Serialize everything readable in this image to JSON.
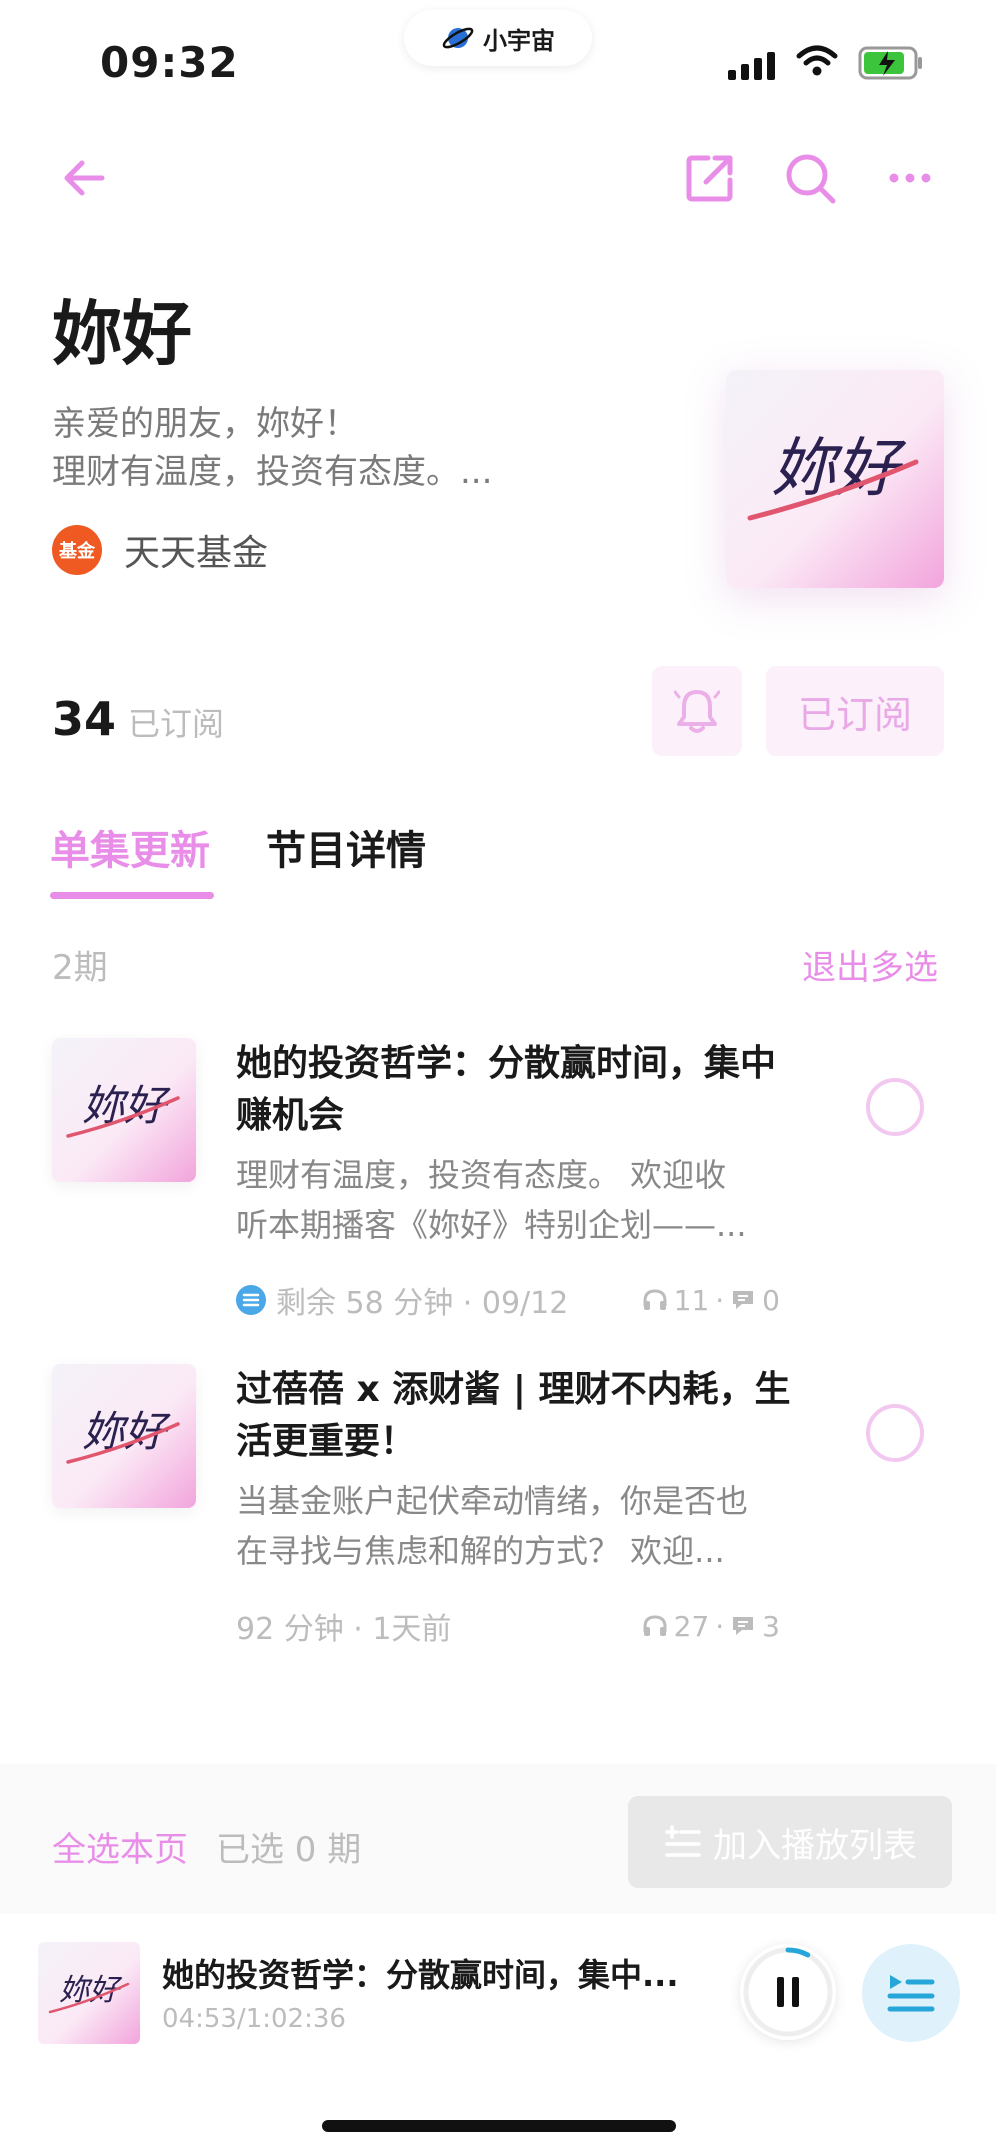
{
  "status": {
    "time": "09:32",
    "pill_label": "小宇宙"
  },
  "podcast": {
    "title": "妳好",
    "description_line1": "亲爱的朋友，妳好！",
    "description_line2": "理财有温度，投资有态度。...",
    "author_badge": "基金",
    "author": "天天基金",
    "cover_text": "妳好",
    "subscriber_count": "34",
    "subscriber_label": "已订阅",
    "subscribe_button": "已订阅"
  },
  "tabs": [
    {
      "label": "单集更新",
      "active": true
    },
    {
      "label": "节目详情",
      "active": false
    }
  ],
  "list": {
    "count": "2期",
    "exit_multiselect": "退出多选"
  },
  "episodes": [
    {
      "thumb_text": "妳好",
      "title": "她的投资哲学：分散赢时间，集中赚机会",
      "desc_line1": "理财有温度，投资有态度。 欢迎收",
      "desc_line2": "听本期播客《妳好》特别企划——...",
      "meta": "剩余 58 分钟 · 09/12",
      "plays": "11",
      "comments": "0"
    },
    {
      "thumb_text": "妳好",
      "title": "过蓓蓓 x 添财酱 | 理财不内耗，生活更重要！",
      "desc_line1": "当基金账户起伏牵动情绪，你是否也",
      "desc_line2": "在寻找与焦虑和解的方式？ 欢迎...",
      "meta": "92 分钟 · 1天前",
      "plays": "27",
      "comments": "3"
    }
  ],
  "selection": {
    "select_all": "全选本页",
    "selected": "已选 0 期",
    "add_to_playlist": "加入播放列表"
  },
  "player": {
    "thumb_text": "妳好",
    "title": "她的投资哲学：分散赢时间，集中...",
    "time": "04:53/1:02:36",
    "progress": 0.078
  },
  "colors": {
    "accent": "#e98ee8",
    "muted": "#bcbcbc",
    "queue_blue": "#26a6d9"
  }
}
